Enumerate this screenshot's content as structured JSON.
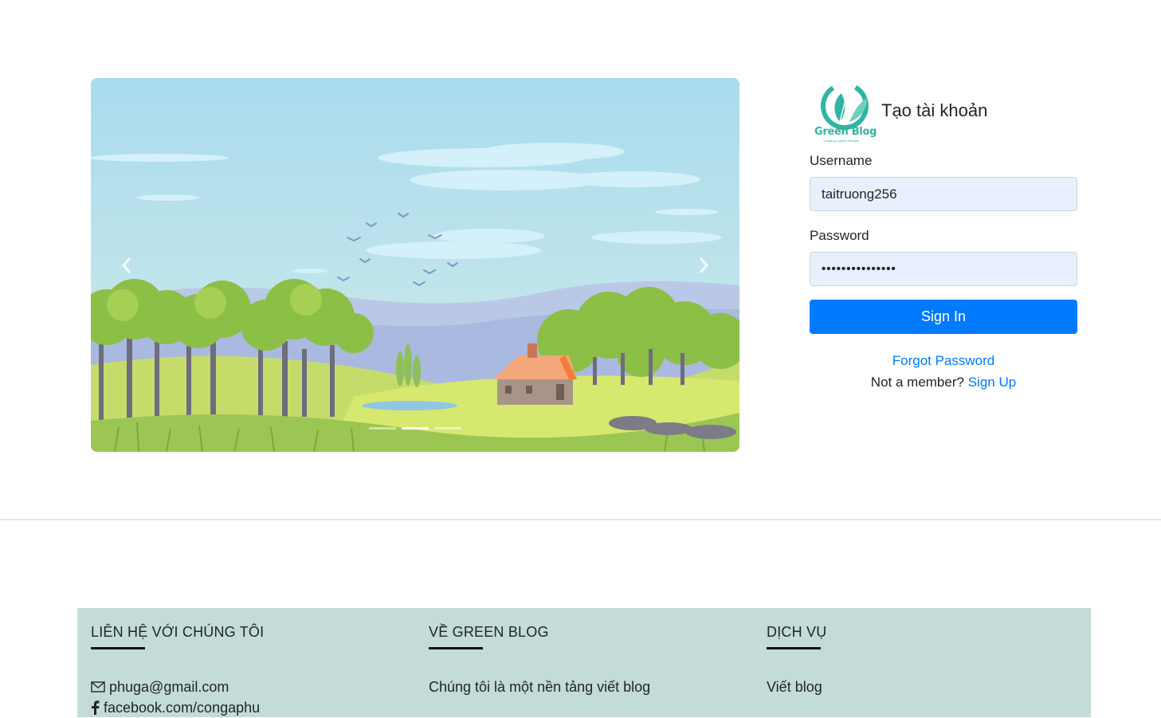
{
  "carousel": {
    "slide_count": 3,
    "active_index": 1,
    "prev_icon": "chevron-left-icon",
    "next_icon": "chevron-right-icon"
  },
  "login": {
    "logo_text": "Green Blog",
    "logo_tagline": "building a green lifestyle",
    "title": "Tạo tài khoản",
    "username_label": "Username",
    "username_value": "taitruong256",
    "password_label": "Password",
    "password_masked": "•••••••••••••••",
    "signin_label": "Sign In",
    "forgot_label": "Forgot Password",
    "not_member_text": "Not a member?",
    "signup_label": "Sign Up"
  },
  "footer": {
    "contact": {
      "heading": "LIÊN HỆ VỚI CHÚNG TÔI",
      "email": "phuga@gmail.com",
      "email_icon": "envelope-icon",
      "facebook": "facebook.com/congaphu",
      "facebook_icon": "facebook-icon"
    },
    "about": {
      "heading": "VỀ GREEN BLOG",
      "text": "Chúng tôi là một nền tảng viết blog"
    },
    "services": {
      "heading": "DỊCH VỤ",
      "text": "Viết blog"
    }
  },
  "colors": {
    "primary": "#007bff",
    "input_bg": "#e8f0fe",
    "footer_bg": "#c3dbd9",
    "brand_green": "#2fb5a2"
  }
}
